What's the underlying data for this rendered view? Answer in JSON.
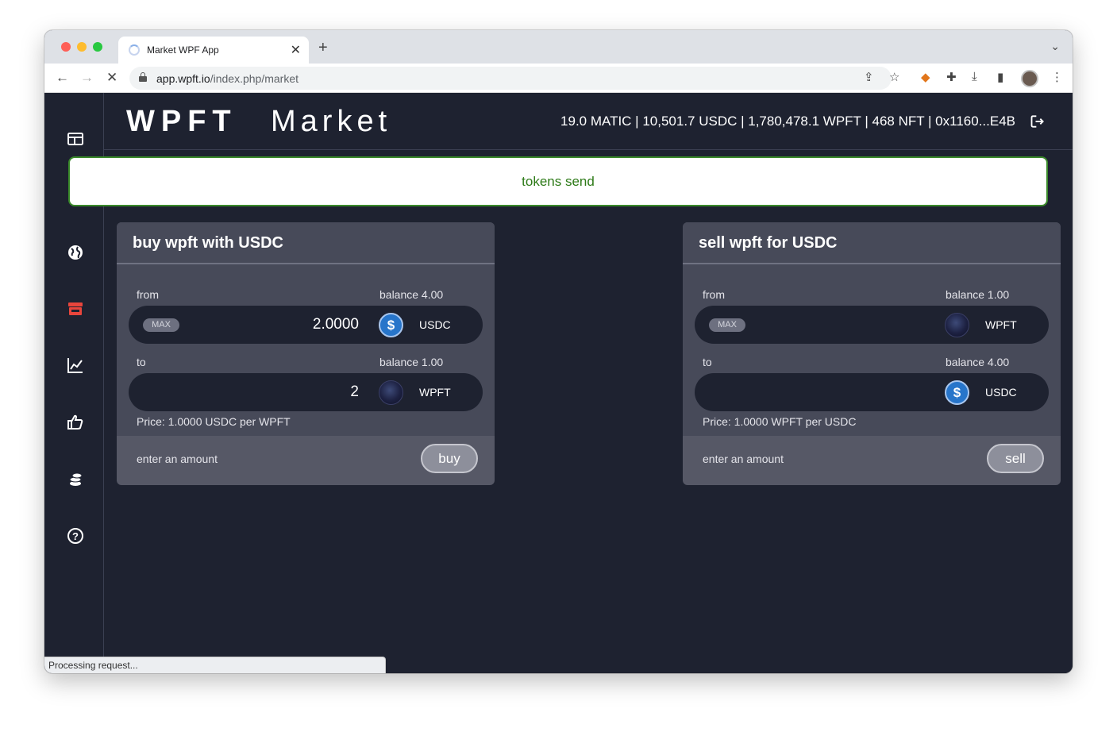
{
  "browser": {
    "tab_title": "Market WPF App",
    "tab_close": "✕",
    "new_tab": "+",
    "url_host": "app.wpft.io",
    "url_path": "/index.php/market",
    "status_text": "Processing request..."
  },
  "header": {
    "brand": "WPFT",
    "page_title": "Market",
    "wallet_info": "19.0 MATIC | 10,501.7 USDC | 1,780,478.1 WPFT | 468 NFT | 0x1160...E4B"
  },
  "sidebar": {
    "items": [
      "dashboard-icon",
      "globe-icon",
      "store-icon",
      "chart-icon",
      "thumbs-up-icon",
      "coins-icon",
      "help-icon"
    ],
    "active": "store-icon",
    "active_color": "#e8453c"
  },
  "notice": {
    "text": "tokens send"
  },
  "buy_panel": {
    "title": "buy wpft with USDC",
    "from_label": "from",
    "from_balance": "balance 4.00",
    "max_label": "MAX",
    "from_amount": "2.0000",
    "from_token": "USDC",
    "to_label": "to",
    "to_balance": "balance 1.00",
    "to_amount": "2",
    "to_token": "WPFT",
    "price": "Price: 1.0000 USDC per WPFT",
    "hint": "enter an amount",
    "action": "buy"
  },
  "sell_panel": {
    "title": "sell wpft for USDC",
    "from_label": "from",
    "from_balance": "balance 1.00",
    "max_label": "MAX",
    "from_amount": "",
    "from_token": "WPFT",
    "to_label": "to",
    "to_balance": "balance 4.00",
    "to_amount": "",
    "to_token": "USDC",
    "price": "Price: 1.0000 WPFT per USDC",
    "hint": "enter an amount",
    "action": "sell"
  },
  "colors": {
    "app_bg": "#1e2230",
    "panel_bg": "#474a59",
    "notice_border": "#3a8a2a",
    "notice_text": "#2d7a17",
    "usdc_blue": "#2775ca"
  }
}
